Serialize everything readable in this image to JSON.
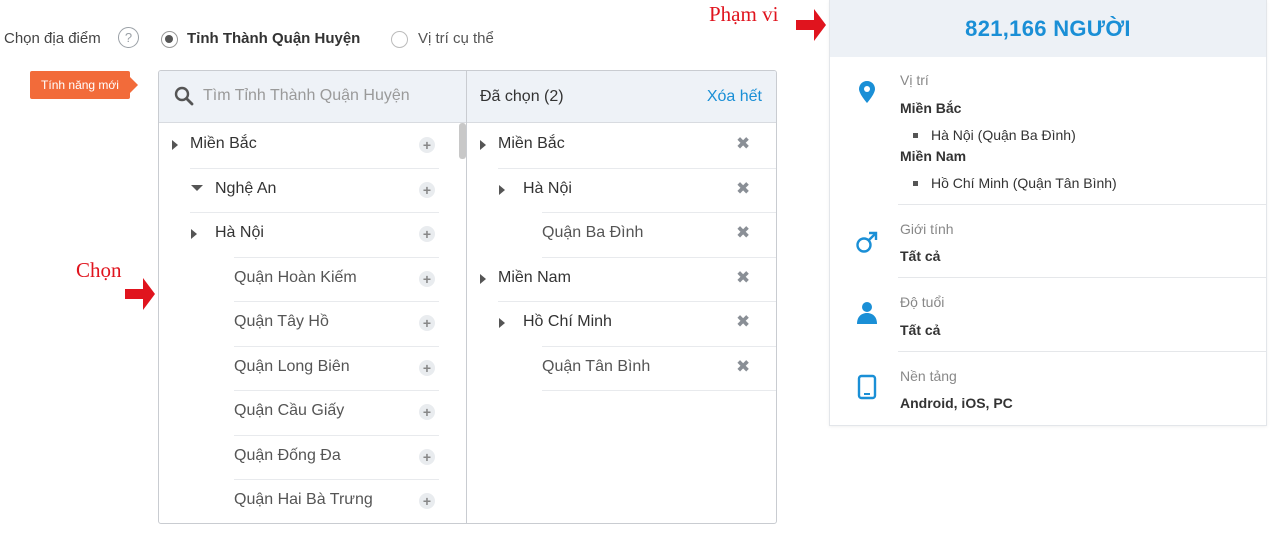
{
  "location": {
    "label": "Chọn địa điểm",
    "help_glyph": "?",
    "options": [
      {
        "label": "Tỉnh Thành Quận Huyện",
        "selected": true
      },
      {
        "label": "Vị trí cụ thể",
        "selected": false
      }
    ],
    "new_badge": "Tính năng mới"
  },
  "annotations": {
    "choose": "Chọn",
    "scope": "Phạm vi",
    "arrow_color": "#e0141e"
  },
  "selector": {
    "search_placeholder": "Tìm Tỉnh Thành Quận Huyện",
    "selected_title": "Đã chọn (2)",
    "clear_all": "Xóa hết",
    "tree": [
      {
        "label": "Miền Bắc",
        "level": 0,
        "toggle": "collapsed"
      },
      {
        "label": "Nghệ An",
        "level": 1,
        "toggle": "expanded"
      },
      {
        "label": "Hà Nội",
        "level": 1,
        "toggle": "collapsed"
      },
      {
        "label": "Quận Hoàn Kiếm",
        "level": 2,
        "toggle": "none"
      },
      {
        "label": "Quận Tây Hồ",
        "level": 2,
        "toggle": "none"
      },
      {
        "label": "Quận Long Biên",
        "level": 2,
        "toggle": "none"
      },
      {
        "label": "Quận Cầu Giấy",
        "level": 2,
        "toggle": "none"
      },
      {
        "label": "Quận Đống Đa",
        "level": 2,
        "toggle": "none"
      },
      {
        "label": "Quận Hai Bà Trưng",
        "level": 2,
        "toggle": "none"
      }
    ],
    "selected": [
      {
        "label": "Miền Bắc",
        "level": 0,
        "toggle": "collapsed"
      },
      {
        "label": "Hà Nội",
        "level": 1,
        "toggle": "collapsed"
      },
      {
        "label": "Quận Ba Đình",
        "level": 2,
        "toggle": "none"
      },
      {
        "label": "Miền Nam",
        "level": 0,
        "toggle": "collapsed"
      },
      {
        "label": "Hồ Chí Minh",
        "level": 1,
        "toggle": "collapsed"
      },
      {
        "label": "Quận Tân Bình",
        "level": 2,
        "toggle": "none"
      }
    ]
  },
  "summary": {
    "reach": "821,166 NGƯỜI",
    "location": {
      "label": "Vị trí",
      "region1": "Miền Bắc",
      "region1_item": "Hà Nội (Quận Ba Đình)",
      "region2": "Miền Nam",
      "region2_item": "Hồ Chí Minh (Quận Tân Bình)"
    },
    "gender": {
      "label": "Giới tính",
      "value": "Tất cả"
    },
    "age": {
      "label": "Độ tuổi",
      "value": "Tất cả"
    },
    "platform": {
      "label": "Nền tảng",
      "value": "Android, iOS, PC"
    },
    "icon_color": "#1a8fd6"
  }
}
